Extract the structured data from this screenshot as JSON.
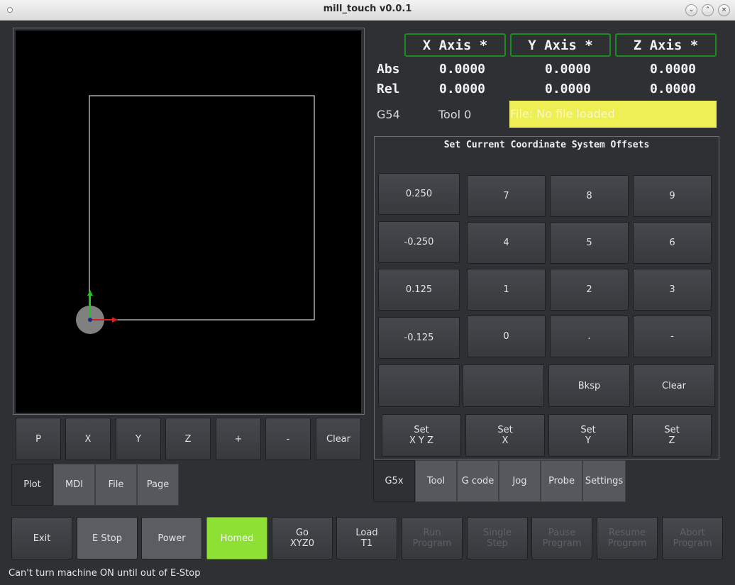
{
  "window": {
    "title": "mill_touch v0.0.1"
  },
  "axes": {
    "headers": [
      "X Axis *",
      "Y Axis *",
      "Z Axis *"
    ],
    "abs_label": "Abs",
    "rel_label": "Rel",
    "abs": [
      "0.0000",
      "0.0000",
      "0.0000"
    ],
    "rel": [
      "0.0000",
      "0.0000",
      "0.0000"
    ]
  },
  "info": {
    "coord_system": "G54",
    "tool": "Tool 0",
    "file": "File: No file loaded"
  },
  "plot_buttons": [
    "P",
    "X",
    "Y",
    "Z",
    "+",
    "-",
    "Clear"
  ],
  "left_tabs": [
    {
      "label": "Plot",
      "active": true
    },
    {
      "label": "MDI",
      "active": false
    },
    {
      "label": "File",
      "active": false
    },
    {
      "label": "Page",
      "active": false
    }
  ],
  "offsets": {
    "title": "Set Current Coordinate System Offsets",
    "increments": [
      "0.250",
      "-0.250",
      "0.125",
      "-0.125"
    ],
    "keypad": [
      "7",
      "8",
      "9",
      "4",
      "5",
      "6",
      "1",
      "2",
      "3",
      "0",
      ".",
      "-"
    ],
    "row5": [
      "",
      "",
      "Bksp",
      "Clear"
    ],
    "set_buttons": [
      "Set\nX Y Z",
      "Set\nX",
      "Set\nY",
      "Set\nZ"
    ]
  },
  "right_tabs": [
    {
      "label": "G5x",
      "active": true
    },
    {
      "label": "Tool",
      "active": false
    },
    {
      "label": "G code",
      "active": false
    },
    {
      "label": "Jog",
      "active": false
    },
    {
      "label": "Probe",
      "active": false
    },
    {
      "label": "Settings",
      "active": false
    }
  ],
  "bottom_buttons": [
    {
      "label": "Exit",
      "state": "normal"
    },
    {
      "label": "E Stop",
      "state": "grey"
    },
    {
      "label": "Power",
      "state": "grey"
    },
    {
      "label": "Homed",
      "state": "green"
    },
    {
      "label": "Go\nXYZ0",
      "state": "normal"
    },
    {
      "label": "Load\nT1",
      "state": "normal"
    },
    {
      "label": "Run\nProgram",
      "state": "disabled"
    },
    {
      "label": "Single\nStep",
      "state": "disabled"
    },
    {
      "label": "Pause\nProgram",
      "state": "disabled"
    },
    {
      "label": "Resume\nProgram",
      "state": "disabled"
    },
    {
      "label": "Abort\nProgram",
      "state": "disabled"
    }
  ],
  "status": "Can't turn machine ON until out of E-Stop",
  "colors": {
    "axis_border": "#1d8a22",
    "file_bg": "#eeee55",
    "homed": "#8ee034"
  }
}
